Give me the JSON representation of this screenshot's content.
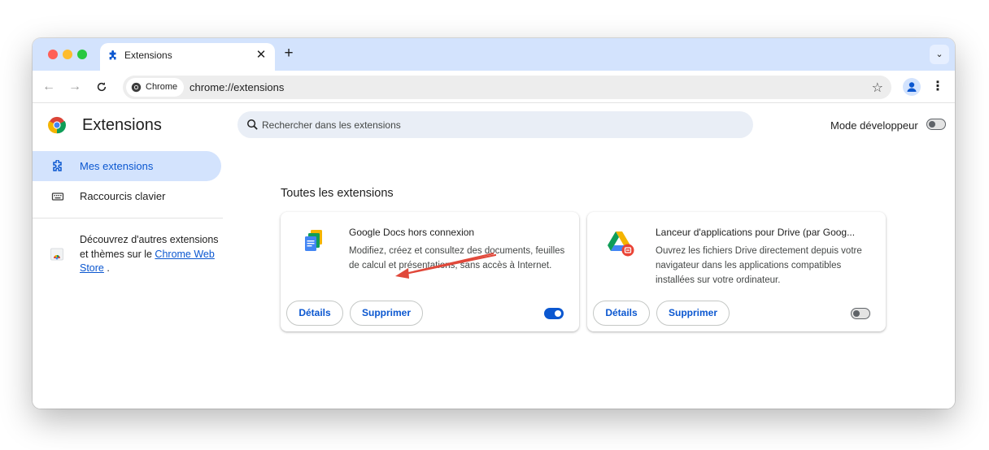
{
  "window": {
    "tab_title": "Extensions",
    "tab_close_glyph": "✕",
    "new_tab_glyph": "+",
    "tab_search_glyph": "⌄"
  },
  "toolbar": {
    "back_glyph": "←",
    "forward_glyph": "→",
    "reload_glyph": "C",
    "chip_label": "Chrome",
    "url": "chrome://extensions",
    "star_glyph": "☆",
    "menu_glyph": "⋮"
  },
  "page": {
    "title": "Extensions",
    "search_placeholder": "Rechercher dans les extensions",
    "developer_mode_label": "Mode développeur",
    "developer_mode_on": false
  },
  "sidebar": {
    "items": [
      {
        "label": "Mes extensions",
        "active": true,
        "icon": "puzzle-icon"
      },
      {
        "label": "Raccourcis clavier",
        "active": false,
        "icon": "keyboard-icon"
      }
    ],
    "store_text_before": "Découvrez d'autres extensions et thèmes sur le",
    "store_link": "Chrome Web Store",
    "store_text_after": " ."
  },
  "section_title": "Toutes les extensions",
  "extensions": [
    {
      "name": "Google Docs hors connexion",
      "description": "Modifiez, créez et consultez des documents, feuilles de calcul et présentations, sans accès à Internet.",
      "details_label": "Détails",
      "remove_label": "Supprimer",
      "enabled": true,
      "icon": "google-docs-icon"
    },
    {
      "name": "Lanceur d'applications pour Drive (par Goog...",
      "description": "Ouvrez les fichiers Drive directement depuis votre navigateur dans les applications compatibles installées sur votre ordinateur.",
      "details_label": "Détails",
      "remove_label": "Supprimer",
      "enabled": false,
      "icon": "google-drive-icon"
    }
  ],
  "colors": {
    "accent": "#0b57d0",
    "tabstrip": "#d3e3fd",
    "annotation_arrow": "#e0483a"
  }
}
